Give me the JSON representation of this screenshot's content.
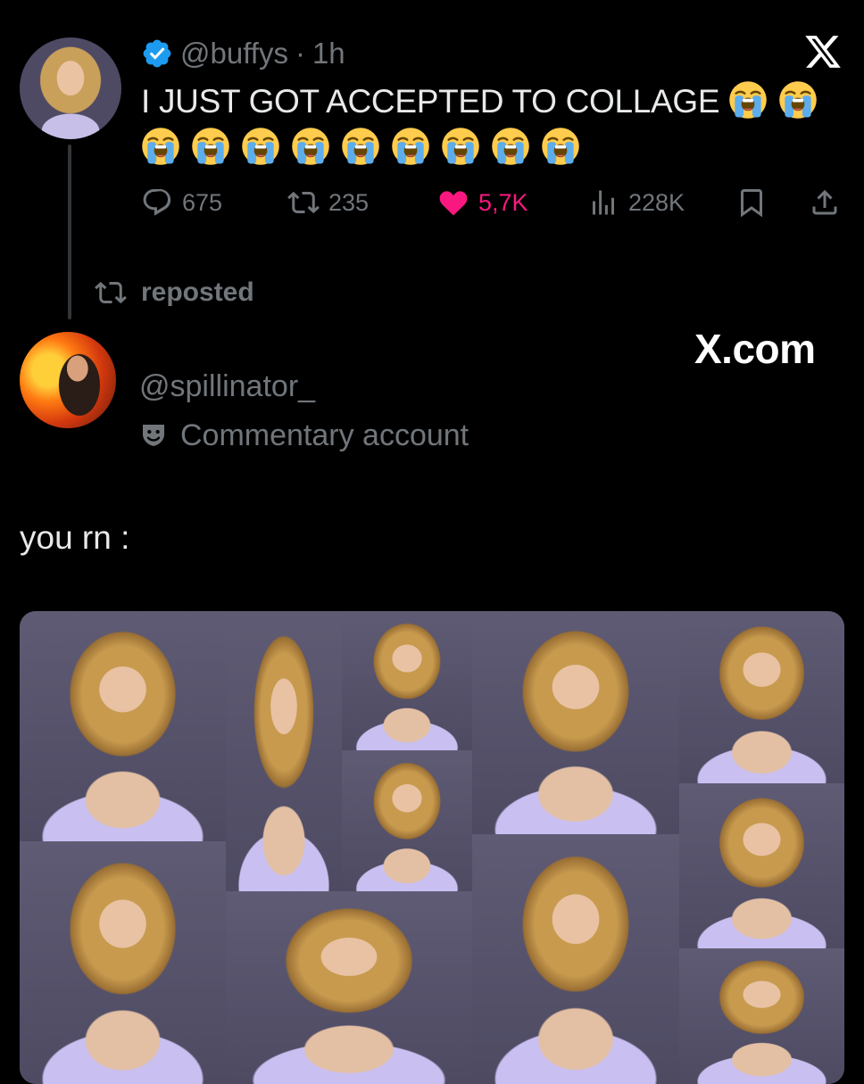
{
  "tweet": {
    "handle": "@buffys",
    "separator": "·",
    "time": "1h",
    "text": "I JUST GOT ACCEPTED TO COLLAGE",
    "emoji_count_line1": 2,
    "emoji_count_line2": 9,
    "emoji": "loudly-crying-face",
    "stats": {
      "replies": "675",
      "reposts": "235",
      "likes": "5,7K",
      "views": "228K"
    }
  },
  "repost_label": "reposted",
  "quote": {
    "brand": "X.com",
    "handle": "@spillinator_",
    "account_label": "Commentary account",
    "text": "you rn :"
  },
  "colors": {
    "background": "#000000",
    "text": "#e7e9ea",
    "muted": "#71767b",
    "like": "#f91880",
    "verified": "#1d9bf0"
  },
  "icons": [
    "verified-badge-icon",
    "x-logo-icon",
    "reply-icon",
    "repost-icon",
    "heart-icon",
    "views-icon",
    "bookmark-icon",
    "share-icon",
    "commentary-mask-icon"
  ]
}
